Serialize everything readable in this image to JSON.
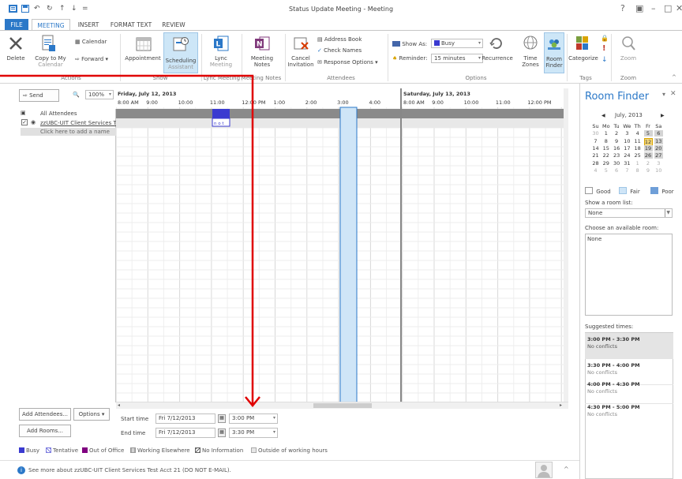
{
  "window": {
    "title": "Status Update Meeting - Meeting",
    "help": "?",
    "controls": [
      "?",
      "▣",
      "–",
      "□",
      "✕"
    ]
  },
  "tabs": [
    "FILE",
    "MEETING",
    "INSERT",
    "FORMAT TEXT",
    "REVIEW"
  ],
  "ribbon": {
    "actions": {
      "delete": "Delete",
      "copy_to_my": "Copy to My",
      "calendar_sub": "Calendar",
      "calendar": "Calendar",
      "forward": "Forward",
      "group": "Actions"
    },
    "show": {
      "appointment": "Appointment",
      "scheduling": "Scheduling",
      "scheduling_sub": "Assistant",
      "group": "Show"
    },
    "lync": {
      "label": "Lync",
      "sub": "Meeting",
      "group": "Lync Meeting"
    },
    "notes": {
      "label": "Meeting",
      "sub": "Notes",
      "group": "Meeting Notes"
    },
    "attendees": {
      "cancel": "Cancel",
      "invitation": "Invitation",
      "address_book": "Address Book",
      "check_names": "Check Names",
      "response_options": "Response Options",
      "group": "Attendees"
    },
    "options": {
      "show_as_label": "Show As:",
      "show_as_value": "Busy",
      "reminder_label": "Reminder:",
      "reminder_value": "15 minutes",
      "recurrence": "Recurrence",
      "time_zones": "Time",
      "time_zones_sub": "Zones",
      "room_finder": "Room",
      "room_finder_sub": "Finder",
      "group": "Options"
    },
    "tags": {
      "categorize": "Categorize",
      "group": "Tags"
    },
    "zoom": {
      "label": "Zoom",
      "group": "Zoom"
    }
  },
  "scheduling": {
    "send": "Send",
    "zoom": "100%",
    "days": [
      {
        "title": "Friday, July 12, 2013",
        "ticks": [
          "8:00 AM",
          "9:00",
          "10:00",
          "11:00",
          "12:00 PM",
          "1:00",
          "2:00",
          "3:00",
          "4:00"
        ]
      },
      {
        "title": "Saturday, July 13, 2013",
        "ticks": [
          "8:00 AM",
          "9:00",
          "10:00",
          "11:00",
          "12:00 PM"
        ]
      }
    ],
    "attendees": {
      "all": "All Attendees",
      "rows": [
        "zzUBC-UIT Client Services Te"
      ],
      "add_placeholder": "Click here to add a name"
    },
    "busy_marker": "n o t"
  },
  "bottom": {
    "add_attendees": "Add Attendees...",
    "options": "Options",
    "add_rooms": "Add Rooms...",
    "start_label": "Start time",
    "start_date": "Fri 7/12/2013",
    "start_time": "3:00 PM",
    "end_label": "End time",
    "end_date": "Fri 7/12/2013",
    "end_time": "3:30 PM"
  },
  "legend": [
    "Busy",
    "Tentative",
    "Out of Office",
    "Working Elsewhere",
    "No Information",
    "Outside of working hours"
  ],
  "status_bar": "See more about zzUBC-UIT Client Services Test Acct 21 (DO NOT E-MAIL).",
  "room_finder": {
    "title": "Room Finder",
    "month": "July, 2013",
    "weekdays": [
      "Su",
      "Mo",
      "Tu",
      "We",
      "Th",
      "Fr",
      "Sa"
    ],
    "weeks": [
      [
        "30",
        "1",
        "2",
        "3",
        "4",
        "5",
        "6"
      ],
      [
        "7",
        "8",
        "9",
        "10",
        "11",
        "12",
        "13"
      ],
      [
        "14",
        "15",
        "16",
        "17",
        "18",
        "19",
        "20"
      ],
      [
        "21",
        "22",
        "23",
        "24",
        "25",
        "26",
        "27"
      ],
      [
        "28",
        "29",
        "30",
        "31",
        "1",
        "2",
        "3"
      ],
      [
        "4",
        "5",
        "6",
        "7",
        "8",
        "9",
        "10"
      ]
    ],
    "legend": {
      "good": "Good",
      "fair": "Fair",
      "poor": "Poor"
    },
    "room_list_label": "Show a room list:",
    "room_list_value": "None",
    "available_label": "Choose an available room:",
    "available_value": "None",
    "suggested_label": "Suggested times:",
    "suggestions": [
      {
        "time": "3:00 PM - 3:30 PM",
        "status": "No conflicts"
      },
      {
        "time": "3:30 PM - 4:00 PM",
        "status": "No conflicts"
      },
      {
        "time": "4:00 PM - 4:30 PM",
        "status": "No conflicts"
      },
      {
        "time": "4:30 PM - 5:00 PM",
        "status": "No conflicts"
      }
    ]
  },
  "colors": {
    "accent": "#2b78c8",
    "annotation_arrow": "#e00000",
    "selection": "#cfe5f7",
    "busy": "#3a3ad0",
    "tentative": "#7f7fe0",
    "out_of_office": "#800080",
    "calendar_today": "#f5d87a"
  }
}
